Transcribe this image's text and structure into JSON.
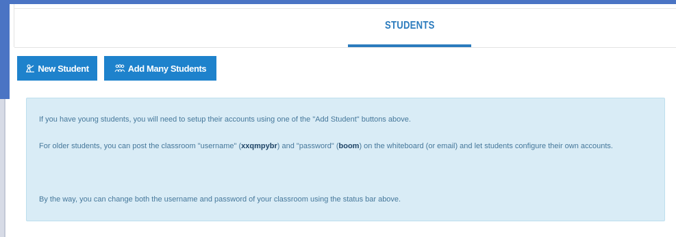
{
  "colors": {
    "accent": "#1e82cc",
    "tab_text": "#2b7bbd",
    "top_bar": "#4a74c4",
    "info_bg": "#d9ecf6",
    "info_border": "#bcdeee",
    "info_text": "#45779a"
  },
  "tabs": {
    "students_label": "STUDENTS"
  },
  "actions": {
    "new_student": {
      "label": "New Student",
      "icon": "person-chalkboard-icon"
    },
    "add_many": {
      "label": "Add Many Students",
      "icon": "group-icon"
    }
  },
  "info": {
    "p1": "If you have young students, you will need to setup their accounts using one of the \"Add Student\" buttons above.",
    "p2_part1": "For older students, you can post the classroom \"username\" (",
    "p2_username": "xxqmpybr",
    "p2_part2": ") and \"password\" (",
    "p2_password": "boom",
    "p2_part3": ") on the whiteboard (or email) and let students configure their own accounts.",
    "p3": "By the way, you can change both the username and password of your classroom using the status bar above."
  }
}
